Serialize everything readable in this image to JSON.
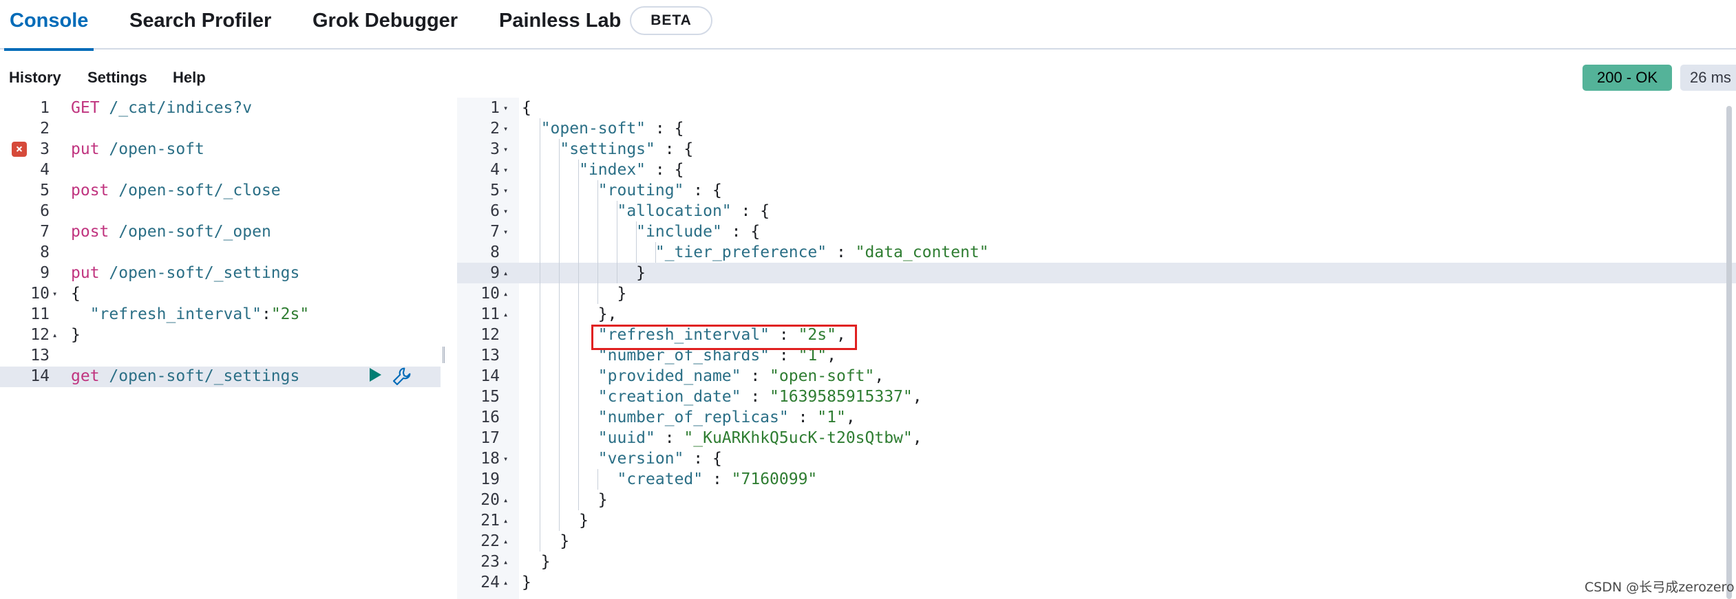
{
  "tabs": [
    {
      "label": "Console"
    },
    {
      "label": "Search Profiler"
    },
    {
      "label": "Grok Debugger"
    },
    {
      "label": "Painless Lab"
    }
  ],
  "beta_badge": "BETA",
  "menu": {
    "history": "History",
    "settings": "Settings",
    "help": "Help"
  },
  "status": {
    "code": "200 - OK",
    "time": "26 ms"
  },
  "request_lines": [
    {
      "num": "1",
      "method": "GET",
      "rest": " /_cat/indices?v"
    },
    {
      "num": "2",
      "method": "",
      "rest": ""
    },
    {
      "num": "3",
      "method": "put",
      "rest": " /open-soft"
    },
    {
      "num": "4",
      "method": "",
      "rest": ""
    },
    {
      "num": "5",
      "method": "post",
      "rest": " /open-soft/_close"
    },
    {
      "num": "6",
      "method": "",
      "rest": ""
    },
    {
      "num": "7",
      "method": "post",
      "rest": " /open-soft/_open"
    },
    {
      "num": "8",
      "method": "",
      "rest": ""
    },
    {
      "num": "9",
      "method": "put",
      "rest": " /open-soft/_settings"
    },
    {
      "num": "10",
      "method": "",
      "rest": "{"
    },
    {
      "num": "11",
      "method": "",
      "rest": "  \"refresh_interval\":\"2s\""
    },
    {
      "num": "12",
      "method": "",
      "rest": "}"
    },
    {
      "num": "13",
      "method": "",
      "rest": ""
    },
    {
      "num": "14",
      "method": "get",
      "rest": " /open-soft/_settings"
    }
  ],
  "response_lines": [
    {
      "num": "1",
      "text": "{"
    },
    {
      "num": "2",
      "text": "  \"open-soft\" : {"
    },
    {
      "num": "3",
      "text": "    \"settings\" : {"
    },
    {
      "num": "4",
      "text": "      \"index\" : {"
    },
    {
      "num": "5",
      "text": "        \"routing\" : {"
    },
    {
      "num": "6",
      "text": "          \"allocation\" : {"
    },
    {
      "num": "7",
      "text": "            \"include\" : {"
    },
    {
      "num": "8",
      "text": "              \"_tier_preference\" : \"data_content\""
    },
    {
      "num": "9",
      "text": "            }"
    },
    {
      "num": "10",
      "text": "          }"
    },
    {
      "num": "11",
      "text": "        },"
    },
    {
      "num": "12",
      "text": "        \"refresh_interval\" : \"2s\","
    },
    {
      "num": "13",
      "text": "        \"number_of_shards\" : \"1\","
    },
    {
      "num": "14",
      "text": "        \"provided_name\" : \"open-soft\","
    },
    {
      "num": "15",
      "text": "        \"creation_date\" : \"1639585915337\","
    },
    {
      "num": "16",
      "text": "        \"number_of_replicas\" : \"1\","
    },
    {
      "num": "17",
      "text": "        \"uuid\" : \"_KuARKhkQ5ucK-t20sQtbw\","
    },
    {
      "num": "18",
      "text": "        \"version\" : {"
    },
    {
      "num": "19",
      "text": "          \"created\" : \"7160099\""
    },
    {
      "num": "20",
      "text": "        }"
    },
    {
      "num": "21",
      "text": "      }"
    },
    {
      "num": "22",
      "text": "    }"
    },
    {
      "num": "23",
      "text": "  }"
    },
    {
      "num": "24",
      "text": "}"
    }
  ],
  "watermark": "CSDN @长弓成zerozero",
  "colors": {
    "accent": "#006bb8",
    "status_ok": "#54b399",
    "error": "#d64a3a",
    "highlight": "#e02020"
  },
  "icons": [
    "error-icon",
    "play-icon",
    "wrench-icon",
    "fold-arrow-icon"
  ]
}
